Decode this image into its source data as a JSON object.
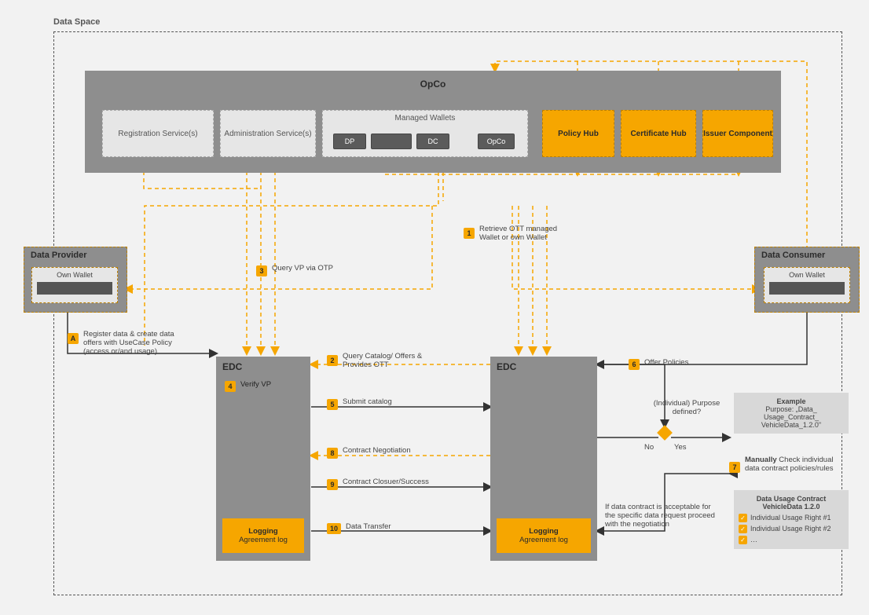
{
  "dataSpace": {
    "label": "Data Space"
  },
  "opco": {
    "title": "OpCo",
    "registration": "Registration Service(s)",
    "admin": "Administration Service(s)",
    "managedWallets": {
      "title": "Managed Wallets",
      "dp": "DP",
      "dc": "DC",
      "opco": "OpCo"
    },
    "policyHub": "Policy Hub",
    "certHub": "Certificate Hub",
    "issuer": "Issuer Component"
  },
  "provider": {
    "title": "Data Provider",
    "wallet": "Own Wallet"
  },
  "consumer": {
    "title": "Data Consumer",
    "wallet": "Own Wallet"
  },
  "edc": {
    "left": {
      "title": "EDC",
      "logging": "Logging",
      "loggingSub": "Agreement log"
    },
    "right": {
      "title": "EDC",
      "logging": "Logging",
      "loggingSub": "Agreement log"
    }
  },
  "steps": {
    "A": {
      "id": "A",
      "text": "Register data & create data offers with UseCase Policy (access or/and usage)"
    },
    "s1": {
      "id": "1",
      "text": "Retrieve OTT managed Wallet or own Wallet"
    },
    "s2": {
      "id": "2",
      "text": "Query Catalog/ Offers & Provides OTT"
    },
    "s3": {
      "id": "3",
      "text": "Query VP via OTP"
    },
    "s4": {
      "id": "4",
      "text": "Verify VP"
    },
    "s5": {
      "id": "5",
      "text": "Submit catalog"
    },
    "s6": {
      "id": "6",
      "text": "Offer Policies"
    },
    "s7": {
      "id": "7",
      "text": "Manually Check individual data contract policies/rules"
    },
    "s8": {
      "id": "8",
      "text": "Contract Negotiation"
    },
    "s9": {
      "id": "9",
      "text": "Contract Closuer/Success"
    },
    "s10": {
      "id": "10",
      "text": "Data Transfer"
    }
  },
  "decision": {
    "label": "(Individual) Purpose defined?",
    "no": "No",
    "yes": "Yes",
    "proceed": "If data contract is acceptable for the specific data request proceed with the negotiation"
  },
  "example": {
    "title": "Example",
    "body": "Purpose: „Data_ Usage_Contract_ VehicleData_1.2.0\""
  },
  "contract": {
    "title": "Data Usage Contract VehicleData 1.2.0",
    "r1": "Individual Usage Right #1",
    "r2": "Individual Usage Right #2",
    "r3": "…"
  }
}
